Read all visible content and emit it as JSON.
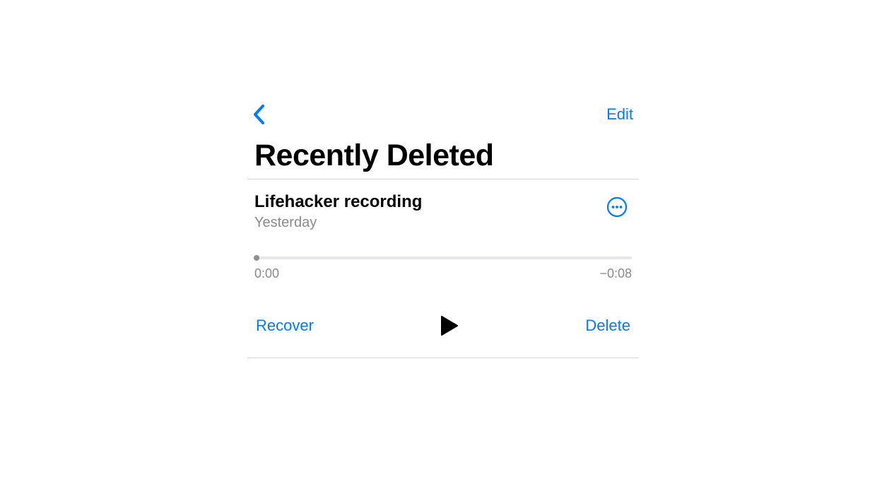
{
  "nav": {
    "edit_label": "Edit"
  },
  "page_title": "Recently Deleted",
  "recording": {
    "title": "Lifehacker recording",
    "subtitle": "Yesterday",
    "time_elapsed": "0:00",
    "time_remaining": "−0:08"
  },
  "controls": {
    "recover_label": "Recover",
    "delete_label": "Delete"
  },
  "colors": {
    "accent": "#007aff",
    "text_primary": "#000000",
    "text_secondary": "#8a8a8e",
    "divider": "#d1d1d6",
    "track": "#e5e5ea",
    "knob": "#8e8e93"
  }
}
